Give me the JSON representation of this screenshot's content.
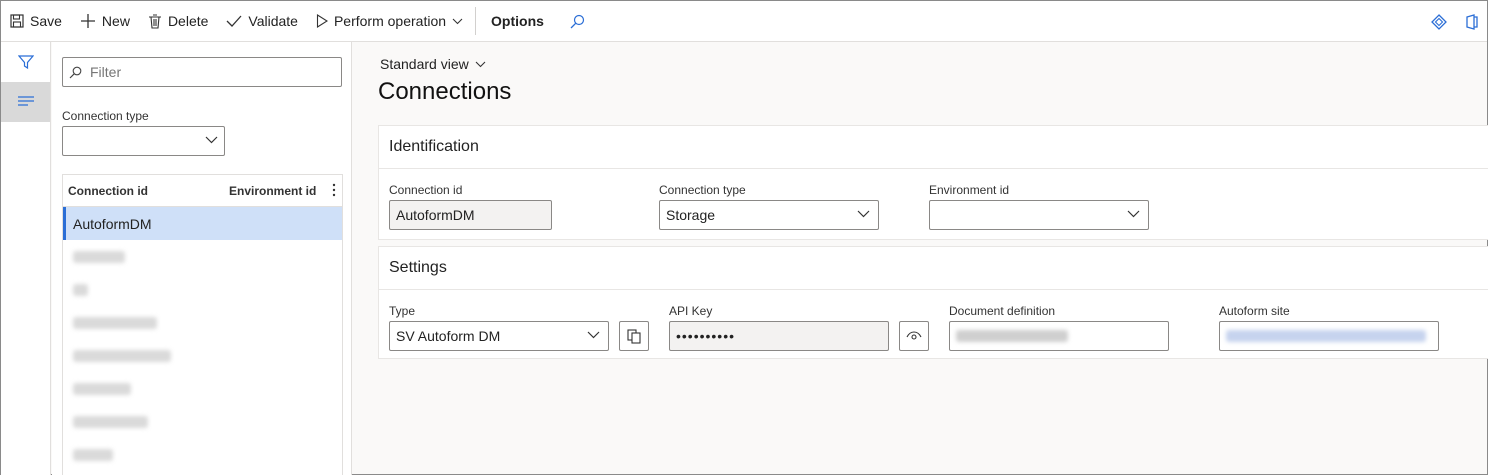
{
  "toolbar": {
    "save": "Save",
    "new": "New",
    "delete": "Delete",
    "validate": "Validate",
    "perform_operation": "Perform operation",
    "options": "Options"
  },
  "list": {
    "filter_placeholder": "Filter",
    "connection_type_label": "Connection type",
    "connection_type_value": "",
    "columns": [
      "Connection id",
      "Environment id"
    ],
    "rows": [
      {
        "connection_id": "AutoformDM",
        "environment_id": "",
        "selected": true
      }
    ]
  },
  "main": {
    "view": "Standard view",
    "title": "Connections",
    "identification": {
      "header": "Identification",
      "connection_id_label": "Connection id",
      "connection_id_value": "AutoformDM",
      "connection_type_label": "Connection type",
      "connection_type_value": "Storage",
      "environment_id_label": "Environment id",
      "environment_id_value": ""
    },
    "settings": {
      "header": "Settings",
      "type_label": "Type",
      "type_value": "SV Autoform DM",
      "api_key_label": "API Key",
      "api_key_value": "••••••••••",
      "document_definition_label": "Document definition",
      "autoform_site_label": "Autoform site"
    }
  },
  "colors": {
    "accent": "#2b6ed6",
    "selected_row": "#cfe0f8"
  }
}
